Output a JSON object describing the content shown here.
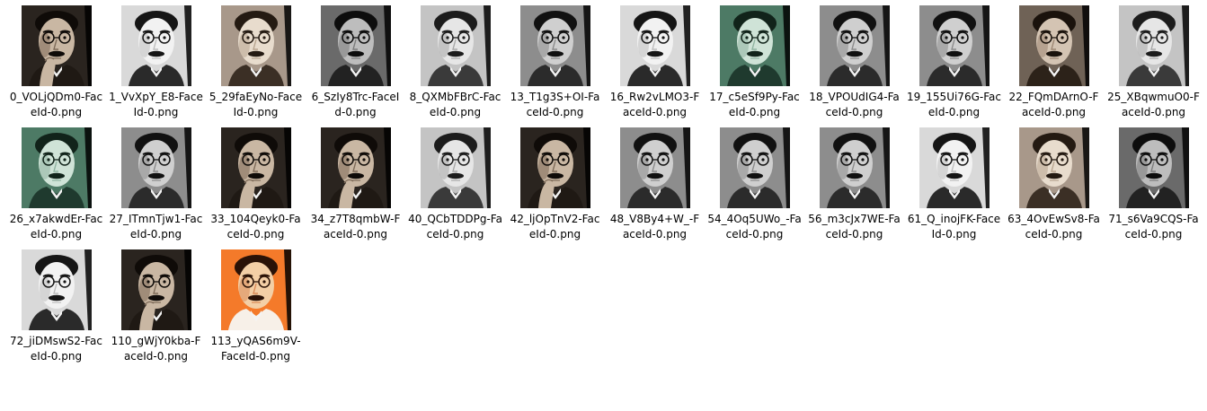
{
  "files": [
    {
      "name": "0_VOLjQDm0-FaceId-0.png",
      "tone": "sepia-dark",
      "pose": "hand"
    },
    {
      "name": "1_VvXpY_E8-FaceId-0.png",
      "tone": "bw-bright",
      "pose": "portrait"
    },
    {
      "name": "5_29faEyNo-FaceId-0.png",
      "tone": "sepia-light",
      "pose": "portrait"
    },
    {
      "name": "6_SzIy8Trc-FaceId-0.png",
      "tone": "bw-dark",
      "pose": "portrait"
    },
    {
      "name": "8_QXMbFBrC-FaceId-0.png",
      "tone": "bw-light",
      "pose": "portrait"
    },
    {
      "name": "13_T1g3S+OI-FaceId-0.png",
      "tone": "bw-mid",
      "pose": "portrait"
    },
    {
      "name": "16_Rw2vLMO3-FaceId-0.png",
      "tone": "bw-bright",
      "pose": "portrait"
    },
    {
      "name": "17_c5eSf9Py-FaceId-0.png",
      "tone": "green",
      "pose": "portrait"
    },
    {
      "name": "18_VPOUdIG4-FaceId-0.png",
      "tone": "bw-mid",
      "pose": "portrait"
    },
    {
      "name": "19_155Ui76G-FaceId-0.png",
      "tone": "bw-mid",
      "pose": "portrait"
    },
    {
      "name": "22_FQmDArnO-FaceId-0.png",
      "tone": "sepia-mid",
      "pose": "portrait"
    },
    {
      "name": "25_XBqwmuO0-FaceId-0.png",
      "tone": "bw-light",
      "pose": "portrait"
    },
    {
      "name": "26_x7akwdEr-FaceId-0.png",
      "tone": "green",
      "pose": "portrait"
    },
    {
      "name": "27_ITmnTjw1-FaceId-0.png",
      "tone": "bw-mid",
      "pose": "portrait"
    },
    {
      "name": "33_104Qeyk0-FaceId-0.png",
      "tone": "sepia-dark",
      "pose": "hand"
    },
    {
      "name": "34_z7T8qmbW-FaceId-0.png",
      "tone": "sepia-dark",
      "pose": "hand"
    },
    {
      "name": "40_QCbTDDPg-FaceId-0.png",
      "tone": "bw-light",
      "pose": "portrait"
    },
    {
      "name": "42_ljOpTnV2-FaceId-0.png",
      "tone": "sepia-dark",
      "pose": "hand"
    },
    {
      "name": "48_V8By4+W_-FaceId-0.png",
      "tone": "bw-mid",
      "pose": "portrait"
    },
    {
      "name": "54_4Oq5UWo_-FaceId-0.png",
      "tone": "bw-mid",
      "pose": "portrait"
    },
    {
      "name": "56_m3cJx7WE-FaceId-0.png",
      "tone": "bw-mid",
      "pose": "portrait"
    },
    {
      "name": "61_Q_inojFK-FaceId-0.png",
      "tone": "bw-bright",
      "pose": "portrait"
    },
    {
      "name": "63_4OvEwSv8-FaceId-0.png",
      "tone": "sepia-light",
      "pose": "portrait"
    },
    {
      "name": "71_s6Va9CQS-FaceId-0.png",
      "tone": "bw-dark",
      "pose": "portrait"
    },
    {
      "name": "72_jiDMswS2-FaceId-0.png",
      "tone": "bw-bright",
      "pose": "portrait"
    },
    {
      "name": "110_gWjY0kba-FaceId-0.png",
      "tone": "sepia-dark",
      "pose": "hand"
    },
    {
      "name": "113_yQAS6m9V-FaceId-0.png",
      "tone": "orange",
      "pose": "portrait"
    }
  ],
  "tones": {
    "bw-bright": {
      "bg": "#d9d9d9",
      "skin": "#f2f2f2",
      "shade": "#bdbdbd",
      "dark": "#151515",
      "coat": "#2a2a2a"
    },
    "bw-light": {
      "bg": "#c4c4c4",
      "skin": "#e6e6e6",
      "shade": "#a8a8a8",
      "dark": "#1c1c1c",
      "coat": "#3a3a3a"
    },
    "bw-mid": {
      "bg": "#8d8d8d",
      "skin": "#cfcfcf",
      "shade": "#8a8a8a",
      "dark": "#111111",
      "coat": "#2b2b2b"
    },
    "bw-dark": {
      "bg": "#6a6a6a",
      "skin": "#bdbdbd",
      "shade": "#7b7b7b",
      "dark": "#0d0d0d",
      "coat": "#222222"
    },
    "sepia-light": {
      "bg": "#a8988a",
      "skin": "#e8dccd",
      "shade": "#b7a48f",
      "dark": "#241a12",
      "coat": "#3b2f25"
    },
    "sepia-mid": {
      "bg": "#6f6256",
      "skin": "#d4c4b3",
      "shade": "#9c8672",
      "dark": "#1a120c",
      "coat": "#2c2219"
    },
    "sepia-dark": {
      "bg": "#2a241f",
      "skin": "#c9b7a3",
      "shade": "#7d6a58",
      "dark": "#0f0b08",
      "coat": "#1f1914"
    },
    "green": {
      "bg": "#4d7a65",
      "skin": "#cfe3d7",
      "shade": "#8fb3a0",
      "dark": "#11231a",
      "coat": "#1f3a2e"
    },
    "orange": {
      "bg": "#f47a2a",
      "skin": "#f3cfa6",
      "shade": "#d98a57",
      "dark": "#2a1207",
      "coat": "#f7f0e8"
    }
  }
}
